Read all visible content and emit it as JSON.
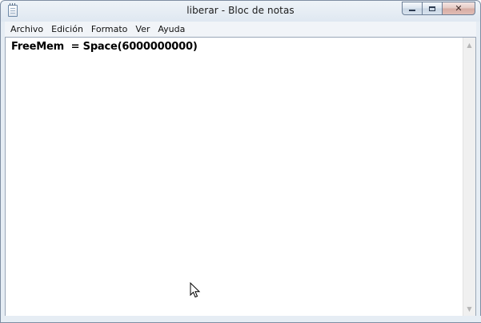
{
  "window": {
    "title": "liberar - Bloc de notas"
  },
  "caption": {
    "minimize_icon": "minimize-icon",
    "maximize_icon": "maximize-icon",
    "close_icon": "close-icon",
    "close_glyph": "✕"
  },
  "menu": {
    "items": [
      "Archivo",
      "Edición",
      "Formato",
      "Ver",
      "Ayuda"
    ]
  },
  "editor": {
    "content": "FreeMem  = Space(6000000000)"
  },
  "scrollbar": {
    "up_glyph": "▲",
    "down_glyph": "▼"
  }
}
